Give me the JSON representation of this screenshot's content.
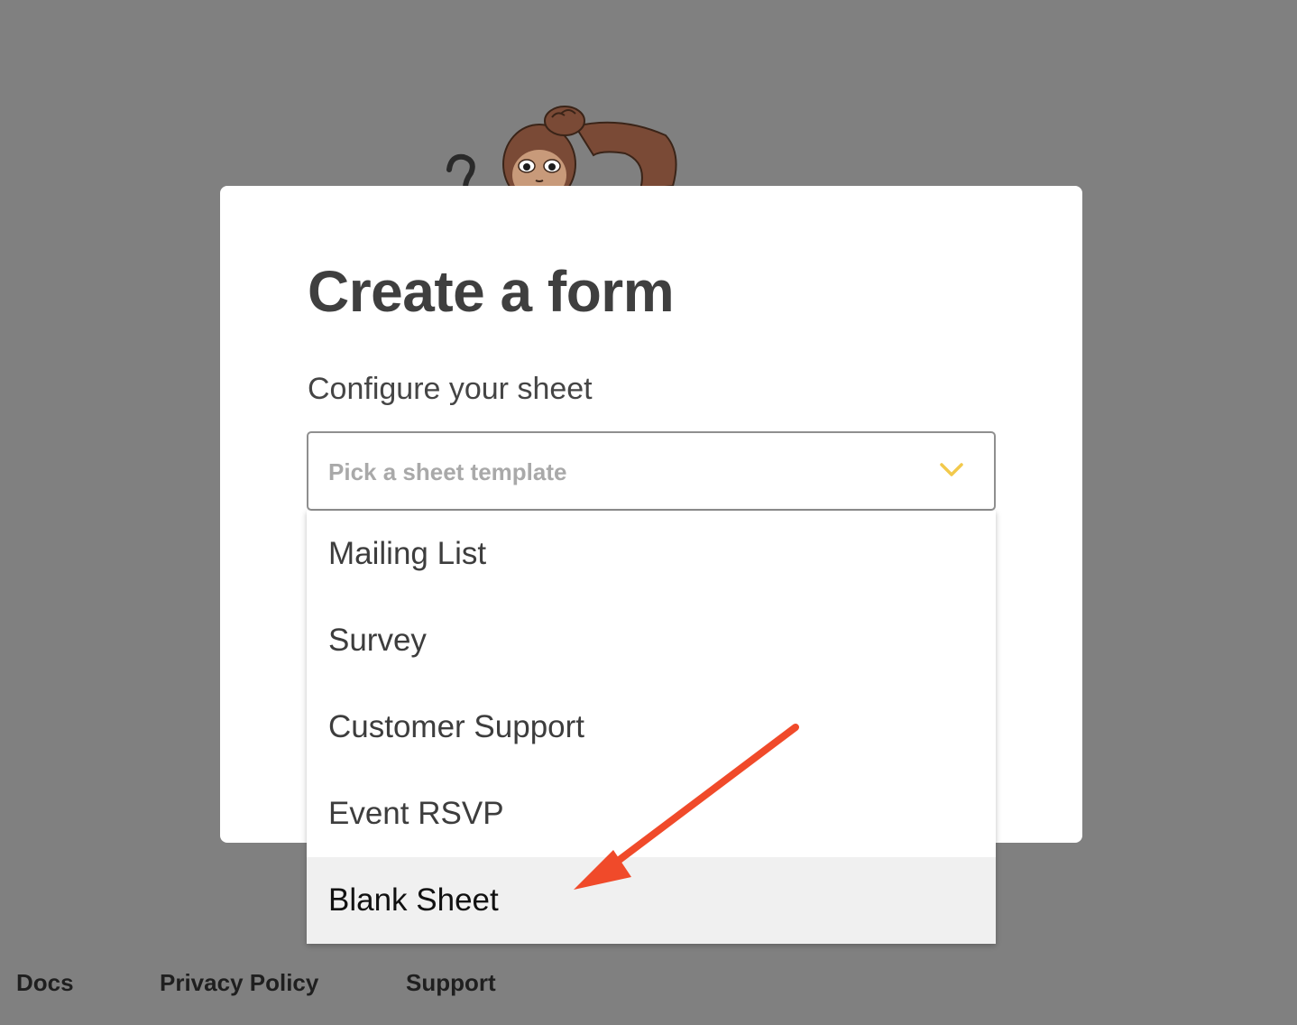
{
  "modal": {
    "title": "Create a form",
    "subtitle": "Configure your sheet"
  },
  "select": {
    "placeholder": "Pick a sheet template",
    "icon": "chevron-down-icon",
    "accent_color": "#f2c94c"
  },
  "dropdown": {
    "options": [
      {
        "label": "Mailing List"
      },
      {
        "label": "Survey"
      },
      {
        "label": "Customer Support"
      },
      {
        "label": "Event RSVP"
      },
      {
        "label": "Blank Sheet",
        "highlighted": true
      }
    ]
  },
  "annotation": {
    "type": "arrow",
    "color": "#f04a2a",
    "points_to": "Blank Sheet"
  },
  "footer": {
    "links": [
      "Docs",
      "Privacy Policy",
      "Support"
    ]
  }
}
